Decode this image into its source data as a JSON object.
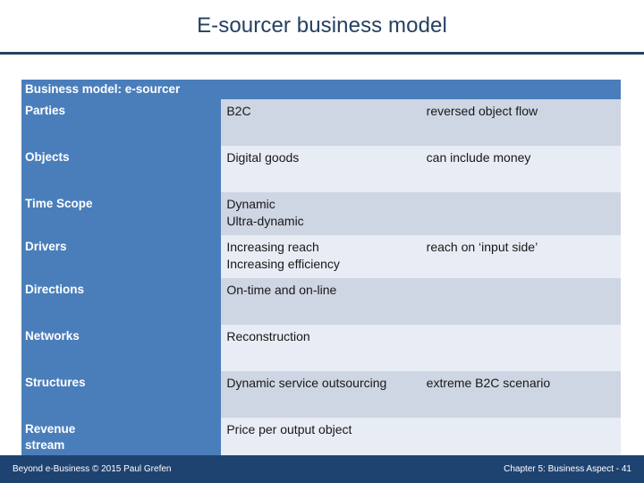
{
  "slide": {
    "title": "E-sourcer business model",
    "accent_color": "#4a7ebb",
    "title_color": "#254061",
    "row_shade_dark": "#ced5e3",
    "row_shade_light": "#e8ecf4",
    "footer_color": "#1f4370"
  },
  "table": {
    "header": "Business model: e-sourcer",
    "rows": [
      {
        "label": "Parties",
        "value": "B2C",
        "value2": "",
        "note": "reversed object flow",
        "size": "tall",
        "shade": "dark"
      },
      {
        "label": "Objects",
        "value": "Digital goods",
        "value2": "",
        "note": "can include money",
        "size": "tall",
        "shade": "light"
      },
      {
        "label": "Time Scope",
        "value": "Dynamic",
        "value2": "Ultra-dynamic",
        "note": "",
        "size": "twoline",
        "shade": "dark"
      },
      {
        "label": "Drivers",
        "value": "Increasing reach",
        "value2": "Increasing efficiency",
        "note": "reach on ‘input side’",
        "size": "twoline",
        "shade": "light"
      },
      {
        "label": "Directions",
        "value": "On-time and on-line",
        "value2": "",
        "note": "",
        "size": "tall",
        "shade": "dark"
      },
      {
        "label": "Networks",
        "value": "Reconstruction",
        "value2": "",
        "note": "",
        "size": "tall",
        "shade": "light"
      },
      {
        "label": "Structures",
        "value": "Dynamic service outsourcing",
        "value2": "",
        "note": "extreme B2C scenario",
        "size": "tall",
        "shade": "dark"
      },
      {
        "label": "Revenue",
        "label2": "stream",
        "value": "Price per output object",
        "value2": "",
        "note": "",
        "size": "tall",
        "shade": "light"
      }
    ]
  },
  "footer": {
    "left": "Beyond e-Business © 2015 Paul Grefen",
    "right": "Chapter 5: Business Aspect - 41"
  }
}
